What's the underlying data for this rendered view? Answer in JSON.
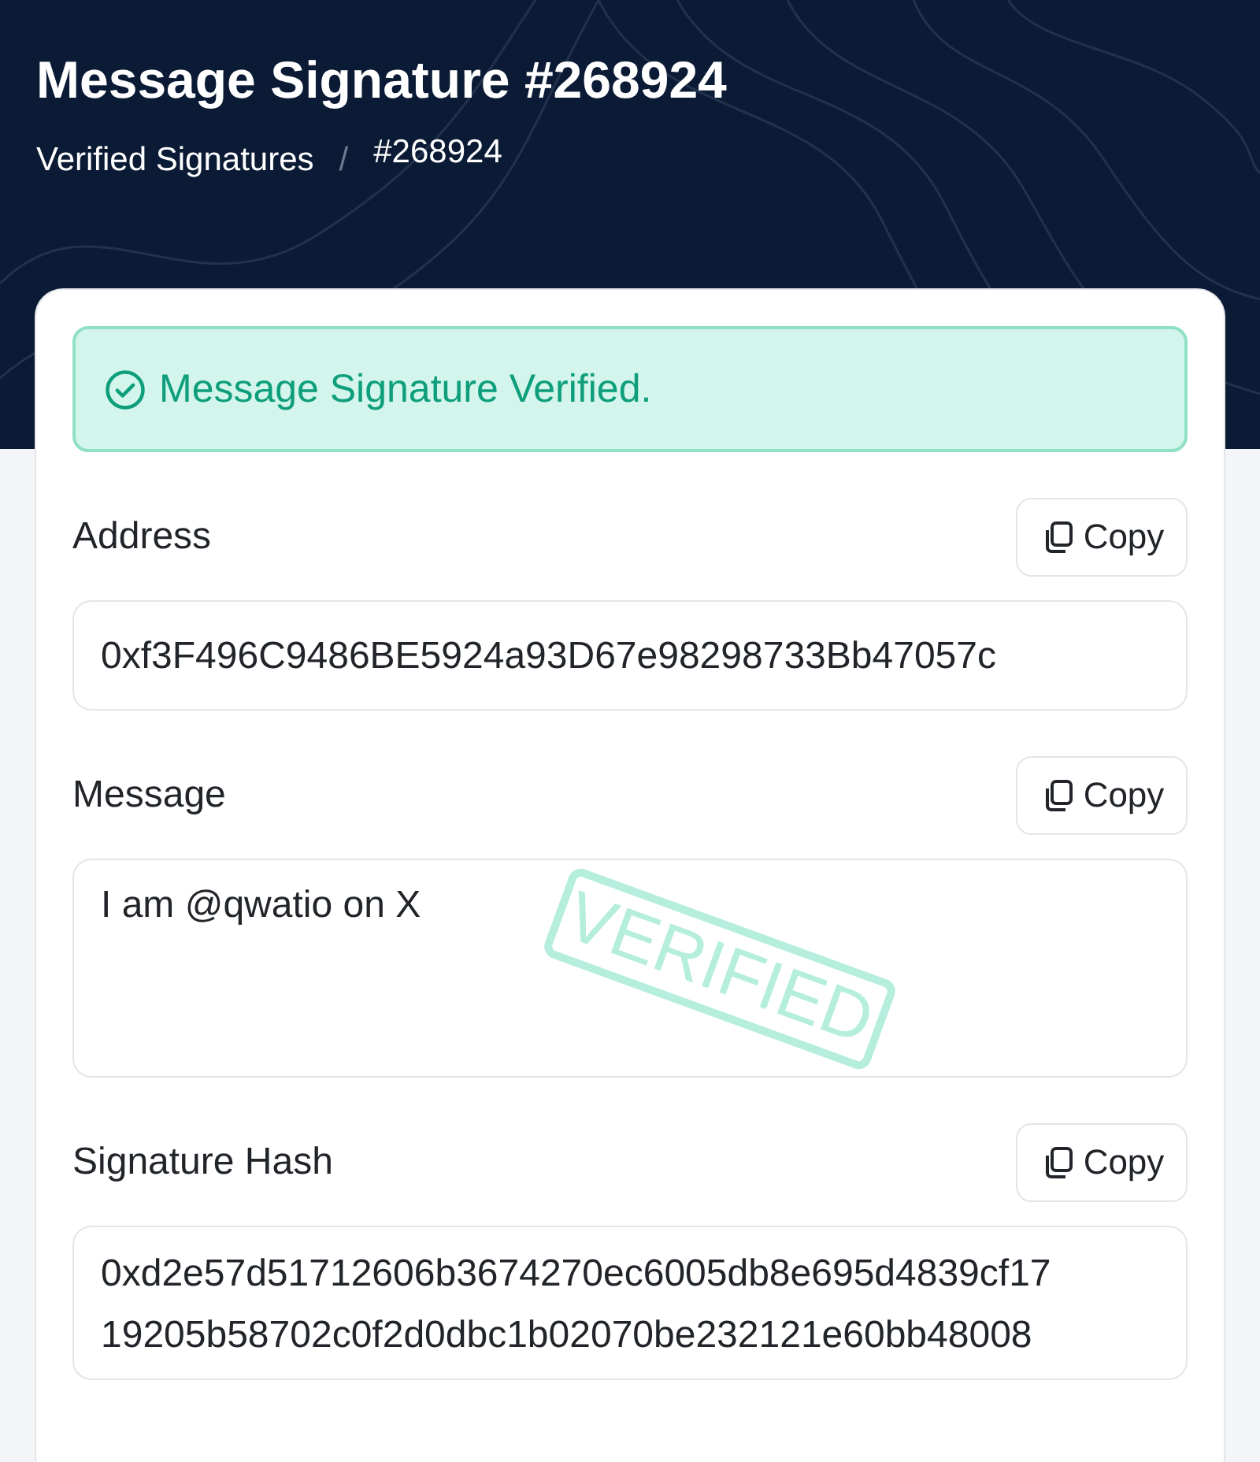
{
  "header": {
    "title": "Message Signature #268924",
    "breadcrumb": [
      "Verified Signatures",
      "#268924"
    ],
    "separator": "/"
  },
  "status": {
    "kind": "success",
    "text": "Message Signature Verified."
  },
  "fields": [
    {
      "label": "Address",
      "copy_label": "Copy",
      "kind": "single",
      "lines": [
        "0xf3F496C9486BE5924a93D67e98298733Bb47057c"
      ]
    },
    {
      "label": "Message",
      "copy_label": "Copy",
      "kind": "multi",
      "lines": [
        "I am @qwatio on X"
      ]
    },
    {
      "label": "Signature Hash",
      "copy_label": "Copy",
      "kind": "scroll",
      "lines": [
        "0xd2e57d51712606b3674270ec6005db8e695d4839cf17",
        "19205b58702c0f2d0dbc1b02070be232121e60bb48008"
      ]
    }
  ],
  "stamp": {
    "text": "VERIFIED"
  }
}
